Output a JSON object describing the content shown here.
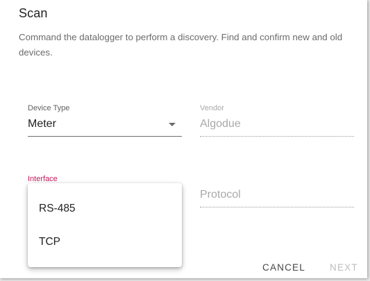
{
  "dialog": {
    "title": "Scan",
    "description": "Command the datalogger to perform a discovery. Find and confirm new and old devices."
  },
  "fields": {
    "device_type": {
      "label": "Device Type",
      "value": "Meter"
    },
    "vendor": {
      "label": "Vendor",
      "value": "Algodue"
    },
    "interface": {
      "label": "Interface"
    },
    "protocol": {
      "label": "Protocol"
    }
  },
  "interface_menu": {
    "options": [
      "RS-485",
      "TCP"
    ]
  },
  "actions": {
    "cancel_label": "CANCEL",
    "next_label": "NEXT"
  },
  "colors": {
    "accent": "#c2185b",
    "text_primary": "#212121",
    "text_secondary": "#6b6b6b",
    "text_disabled": "#a9a9a9"
  },
  "icons": {
    "device_type_dropdown": "caret-down-icon"
  }
}
